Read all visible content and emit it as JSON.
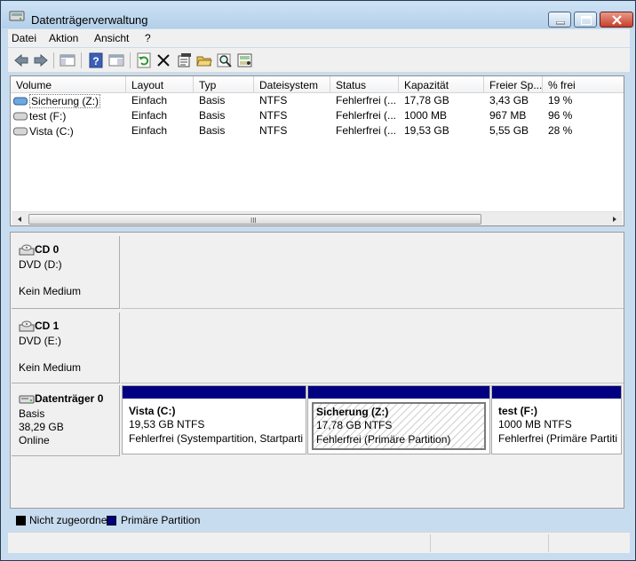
{
  "window": {
    "title": "Datenträgerverwaltung"
  },
  "menu": {
    "items": [
      "Datei",
      "Aktion",
      "Ansicht",
      "?"
    ]
  },
  "toolbar": {
    "icons": [
      "back-arrow-icon",
      "forward-arrow-icon",
      "show-hide-console-tree-icon",
      "help-icon",
      "console-pane-icon",
      "refresh-icon",
      "delete-icon",
      "properties-icon",
      "open-folder-icon",
      "search-icon",
      "rescan-disks-icon"
    ]
  },
  "volume_list": {
    "columns": [
      "Volume",
      "Layout",
      "Typ",
      "Dateisystem",
      "Status",
      "Kapazität",
      "Freier Sp...",
      "% frei"
    ],
    "rows": [
      {
        "volume": "Sicherung (Z:)",
        "layout": "Einfach",
        "typ": "Basis",
        "dateisystem": "NTFS",
        "status": "Fehlerfrei (...",
        "kapazitaet": "17,78 GB",
        "frei": "3,43 GB",
        "prozent": "19 %"
      },
      {
        "volume": "test (F:)",
        "layout": "Einfach",
        "typ": "Basis",
        "dateisystem": "NTFS",
        "status": "Fehlerfrei (...",
        "kapazitaet": "1000 MB",
        "frei": "967 MB",
        "prozent": "96 %"
      },
      {
        "volume": "Vista (C:)",
        "layout": "Einfach",
        "typ": "Basis",
        "dateisystem": "NTFS",
        "status": "Fehlerfrei (...",
        "kapazitaet": "19,53 GB",
        "frei": "5,55 GB",
        "prozent": "28 %"
      }
    ],
    "scroll_grip": "III"
  },
  "disks": {
    "cd0": {
      "name": "CD 0",
      "drive": "DVD (D:)",
      "media": "Kein Medium"
    },
    "cd1": {
      "name": "CD 1",
      "drive": "DVD (E:)",
      "media": "Kein Medium"
    },
    "disk0": {
      "name": "Datenträger 0",
      "type": "Basis",
      "size": "38,29 GB",
      "state": "Online"
    }
  },
  "partitions": [
    {
      "name": "Vista  (C:)",
      "size": "19,53 GB NTFS",
      "status": "Fehlerfrei (Systempartition, Startparti"
    },
    {
      "name": "Sicherung  (Z:)",
      "size": "17,78 GB NTFS",
      "status": "Fehlerfrei (Primäre Partition)"
    },
    {
      "name": "test  (F:)",
      "size": "1000 MB NTFS",
      "status": "Fehlerfrei (Primäre Partiti"
    }
  ],
  "legend": {
    "unallocated": "Nicht zugeordnet",
    "primary": "Primäre Partition",
    "unallocated_color": "#000000",
    "primary_color": "#000080"
  }
}
